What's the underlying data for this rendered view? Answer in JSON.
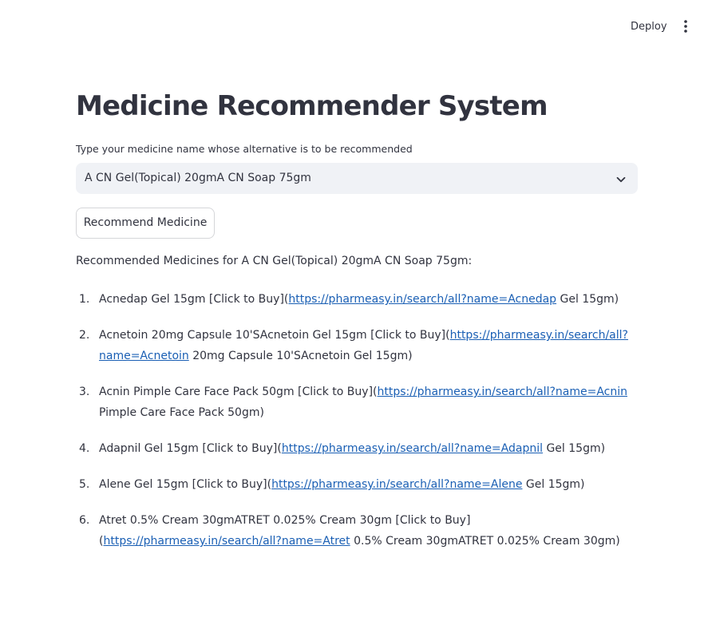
{
  "header": {
    "deploy_label": "Deploy",
    "menu_icon": "vertical-ellipsis-icon"
  },
  "main": {
    "title": "Medicine Recommender System",
    "select_label": "Type your medicine name whose alternative is to be recommended",
    "select_value": "A CN Gel(Topical) 20gmA CN Soap 75gm",
    "button_label": "Recommend Medicine",
    "result_heading": "Recommended Medicines for A CN Gel(Topical) 20gmA CN Soap 75gm:"
  },
  "results": [
    {
      "number": "1.",
      "pre": "Acnedap Gel 15gm [Click to Buy](",
      "link": "https://pharmeasy.in/search/all?name=Acnedap",
      "post": " Gel 15gm)"
    },
    {
      "number": "2.",
      "pre": "Acnetoin 20mg Capsule 10'SAcnetoin Gel 15gm [Click to Buy](",
      "link": "https://pharmeasy.in/search/all?name=Acnetoin",
      "post": " 20mg Capsule 10'SAcnetoin Gel 15gm)"
    },
    {
      "number": "3.",
      "pre": "Acnin Pimple Care Face Pack 50gm [Click to Buy](",
      "link": "https://pharmeasy.in/search/all?name=Acnin",
      "post": " Pimple Care Face Pack 50gm)"
    },
    {
      "number": "4.",
      "pre": "Adapnil Gel 15gm [Click to Buy](",
      "link": "https://pharmeasy.in/search/all?name=Adapnil",
      "post": " Gel 15gm)"
    },
    {
      "number": "5.",
      "pre": "Alene Gel 15gm [Click to Buy](",
      "link": "https://pharmeasy.in/search/all?name=Alene",
      "post": " Gel 15gm)"
    },
    {
      "number": "6.",
      "pre": "Atret 0.5% Cream 30gmATRET 0.025% Cream 30gm [Click to Buy](",
      "link": "https://pharmeasy.in/search/all?name=Atret",
      "post": " 0.5% Cream 30gmATRET 0.025% Cream 30gm)"
    }
  ]
}
